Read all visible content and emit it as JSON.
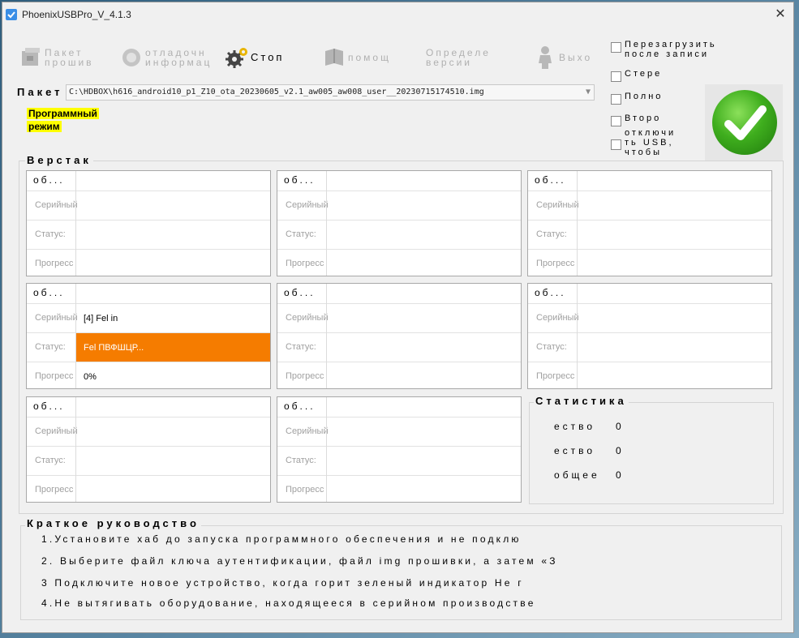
{
  "window": {
    "title": "PhoenixUSBPro_V_4.1.3",
    "close_glyph": "✕"
  },
  "toolbar": {
    "items": [
      {
        "label": "Пакет\nпрошив",
        "icon": "package-icon",
        "active": false
      },
      {
        "label": "отладочн\nинформац",
        "icon": "debug-icon",
        "active": false
      },
      {
        "label": "Стоп",
        "icon": "gears-icon",
        "active": true
      },
      {
        "label": "помощ",
        "icon": "help-book-icon",
        "active": false
      },
      {
        "label": "Определе\nверсии",
        "icon": "version-icon",
        "active": false
      },
      {
        "label": "Выхо",
        "icon": "exit-person-icon",
        "active": false
      }
    ]
  },
  "package": {
    "label": "Пакет",
    "path": "C:\\HDBOX\\h616_android10_p1_Z10_ota_20230605_v2.1_aw005_aw008_user__20230715174510.img"
  },
  "mode": {
    "line1": "Программный",
    "line2": "режим"
  },
  "options": [
    {
      "label": "Перезагрузить\nпосле записи",
      "checked": false
    },
    {
      "label": "Стере",
      "checked": false
    },
    {
      "label": "Полно",
      "checked": false
    },
    {
      "label": "Второ",
      "checked": false
    },
    {
      "label": "отключи\nть USB,\nчтобы",
      "checked": false
    }
  ],
  "status_indicator": {
    "state": "ready",
    "icon": "green-check-icon",
    "color": "#2f9e17"
  },
  "workbench": {
    "title": "Верстак",
    "slot_title": "об...",
    "row_labels": {
      "serial": "Серийный",
      "status": "Статус:",
      "progress": "Прогресс"
    },
    "slots": [
      {
        "serial": "",
        "status": "",
        "progress": ""
      },
      {
        "serial": "",
        "status": "",
        "progress": ""
      },
      {
        "serial": "",
        "status": "",
        "progress": ""
      },
      {
        "serial": "[4] Fel in",
        "status": "Fel ПВФШЦР...",
        "progress": "0%"
      },
      {
        "serial": "",
        "status": "",
        "progress": ""
      },
      {
        "serial": "",
        "status": "",
        "progress": ""
      },
      {
        "serial": "",
        "status": "",
        "progress": ""
      },
      {
        "serial": "",
        "status": "",
        "progress": ""
      }
    ],
    "highlight_color": "#f57c00"
  },
  "stats": {
    "title": "Статистика",
    "rows": [
      {
        "label": "ество",
        "value": "0"
      },
      {
        "label": "ество",
        "value": "0"
      },
      {
        "label": "общее",
        "value": "0"
      }
    ]
  },
  "guide": {
    "title": "Краткое руководство",
    "lines": [
      "1.Установите хаб до запуска программного обеспечения и не подклю",
      "2. Выберите файл ключа аутентификации, файл img прошивки, а затем «З",
      "3 Подключите новое устройство, когда горит зеленый индикатор Не г",
      "4.Не вытягивать оборудование, находящееся в серийном производстве"
    ]
  }
}
